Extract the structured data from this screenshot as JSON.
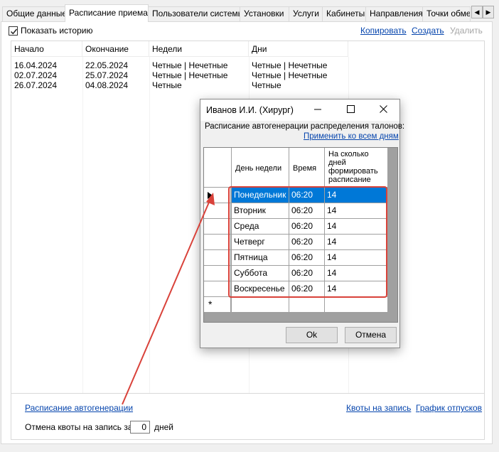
{
  "tabs": [
    {
      "label": "Общие данные"
    },
    {
      "label": "Расписание приема"
    },
    {
      "label": "Пользователи системы"
    },
    {
      "label": "Установки"
    },
    {
      "label": "Услуги"
    },
    {
      "label": "Кабинеты"
    },
    {
      "label": "Направления"
    },
    {
      "label": "Точки обме"
    }
  ],
  "active_tab": 1,
  "toolbar": {
    "show_history": "Показать историю",
    "show_history_checked": true,
    "copy": "Копировать",
    "create": "Создать",
    "delete": "Удалить"
  },
  "history": {
    "columns": [
      "Начало",
      "Окончание",
      "Недели",
      "Дни"
    ],
    "rows": [
      [
        "16.04.2024",
        "22.05.2024",
        "Четные | Нечетные",
        "Четные | Нечетные"
      ],
      [
        "02.07.2024",
        "25.07.2024",
        "Четные | Нечетные",
        "Четные | Нечетные"
      ],
      [
        "26.07.2024",
        "04.08.2024",
        "Четные",
        "Четные"
      ]
    ]
  },
  "bottom": {
    "autogen_link": "Расписание автогенерации",
    "quotas_link": "Квоты на запись",
    "vacations_link": "График отпусков",
    "cancel_prefix": "Отмена квоты на запись за",
    "cancel_value": "0",
    "cancel_suffix": "дней"
  },
  "dialog": {
    "title": "Иванов И.И. (Хирург)",
    "caption": "Расписание автогенерации распределения талонов:",
    "apply_all": "Применить ко всем дням",
    "columns": [
      "День недели",
      "Время",
      "На сколько дней формировать расписание"
    ],
    "rows": [
      {
        "day": "Понедельник",
        "time": "06:20",
        "days": "14"
      },
      {
        "day": "Вторник",
        "time": "06:20",
        "days": "14"
      },
      {
        "day": "Среда",
        "time": "06:20",
        "days": "14"
      },
      {
        "day": "Четверг",
        "time": "06:20",
        "days": "14"
      },
      {
        "day": "Пятница",
        "time": "06:20",
        "days": "14"
      },
      {
        "day": "Суббота",
        "time": "06:20",
        "days": "14"
      },
      {
        "day": "Воскресенье",
        "time": "06:20",
        "days": "14"
      }
    ],
    "selected_row": 0,
    "new_row_marker": "*",
    "ok": "Ok",
    "cancel": "Отмена"
  },
  "colors": {
    "selection": "#0078d7",
    "link": "#0645ad",
    "annotation": "#d9423a"
  }
}
